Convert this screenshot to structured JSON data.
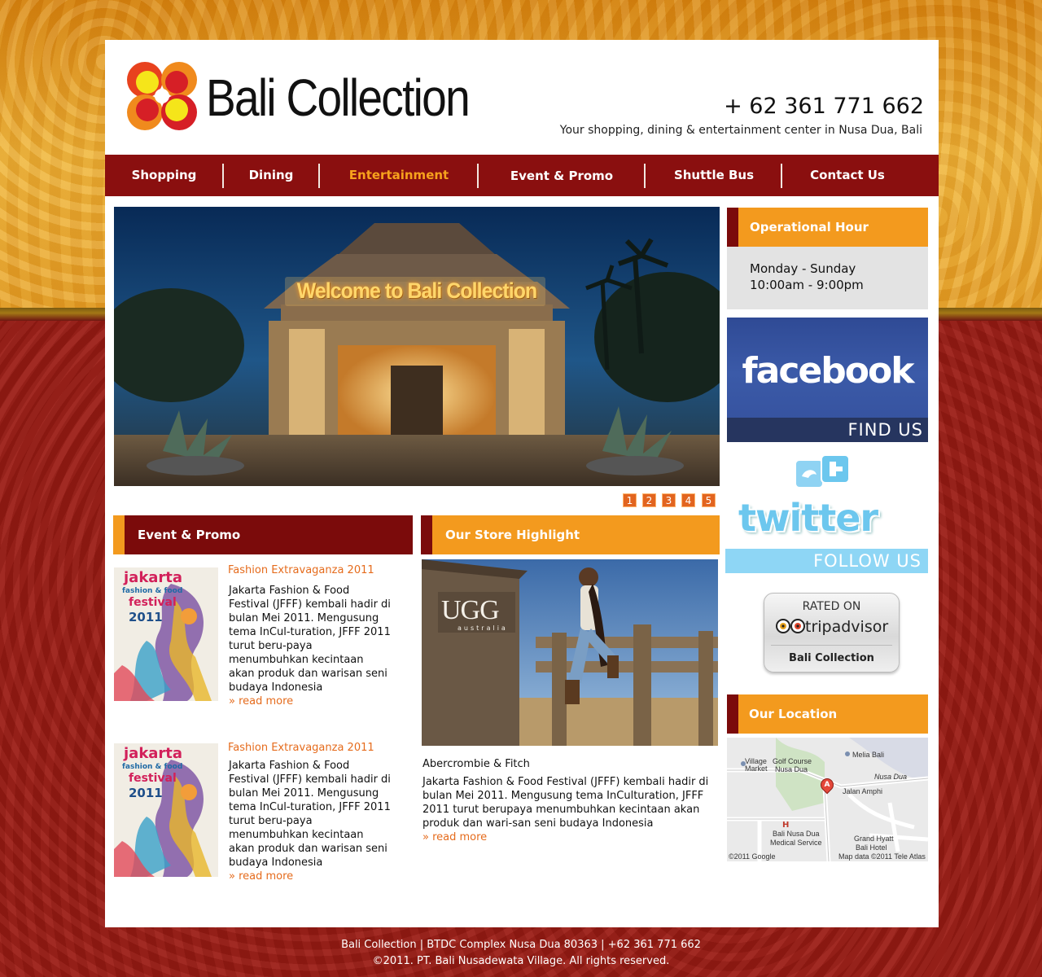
{
  "header": {
    "brand": "Bali Collection",
    "phone": "+ 62 361 771 662",
    "tagline": "Your shopping, dining & entertainment center in Nusa Dua, Bali"
  },
  "nav": {
    "items": [
      {
        "label": "Shopping"
      },
      {
        "label": "Dining"
      },
      {
        "label": "Entertainment",
        "active": true
      },
      {
        "label": "Event & Promo"
      },
      {
        "label": "Shuttle Bus"
      },
      {
        "label": "Contact Us"
      }
    ]
  },
  "hero": {
    "sign_text": "Welcome to Bali Collection",
    "pages": [
      "1",
      "2",
      "3",
      "4",
      "5"
    ]
  },
  "event_promo": {
    "title": "Event & Promo",
    "items": [
      {
        "title": "Fashion Extravaganza 2011",
        "poster_lines": [
          "jakarta",
          "fashion & food",
          "festival",
          "2011"
        ],
        "text": "Jakarta Fashion & Food Festival (JFFF) kembali hadir di bulan Mei 2011. Mengusung tema InCul-turation, JFFF 2011 turut beru-paya menumbuhkan kecintaan akan produk dan warisan seni budaya Indonesia",
        "read_more": "» read more"
      },
      {
        "title": "Fashion Extravaganza 2011",
        "poster_lines": [
          "jakarta",
          "fashion & food",
          "festival",
          "2011"
        ],
        "text": "Jakarta Fashion & Food Festival (JFFF) kembali hadir di bulan Mei 2011. Mengusung tema InCul-turation, JFFF 2011 turut beru-paya menumbuhkan kecintaan akan produk dan warisan seni budaya Indonesia",
        "read_more": "» read more"
      }
    ]
  },
  "store_highlight": {
    "title": "Our Store Highlight",
    "brand_logo": "UGG",
    "brand_sub": "australia",
    "store_name": "Abercrombie & Fitch",
    "text": "Jakarta Fashion & Food Festival (JFFF) kembali hadir di bulan Mei 2011. Mengusung tema InCulturation, JFFF 2011 turut berupaya menumbuhkan kecintaan akan produk dan wari-san seni budaya Indonesia",
    "read_more": "» read more"
  },
  "sidebar": {
    "hours_title": "Operational Hour",
    "hours_days": "Monday - Sunday",
    "hours_time": "10:00am - 9:00pm",
    "facebook_word": "facebook",
    "facebook_cta": "FIND US",
    "twitter_word": "twitter",
    "twitter_cta": "FOLLOW US",
    "ta_rated": "RATED ON",
    "ta_brand": "tripadvisor",
    "ta_name": "Bali Collection",
    "location_title": "Our Location",
    "map_labels": {
      "village": "Village",
      "market": "Market",
      "golf1": "Golf Course",
      "golf2": "Nusa Dua",
      "melia": "Melia Bali",
      "nusadua": "Nusa Dua",
      "amphi": "Jalan Amphi",
      "hosp1": "Bali Nusa Dua",
      "hosp2": "Medical Service",
      "grand1": "Grand Hyatt",
      "grand2": "Bali Hotel",
      "copyright": "©2011 Google",
      "mapdata": "Map data ©2011 Tele Atlas",
      "marker": "A",
      "hosp_marker": "H"
    }
  },
  "footer": {
    "line1": "Bali Collection | BTDC Complex Nusa Dua 80363  | +62 361 771 662",
    "line2": "©2011. PT. Bali Nusadewata Village. All rights reserved."
  },
  "colors": {
    "nav_red": "#8a0f0f",
    "accent_orange": "#f39a1e",
    "link_orange": "#e56b1c"
  }
}
